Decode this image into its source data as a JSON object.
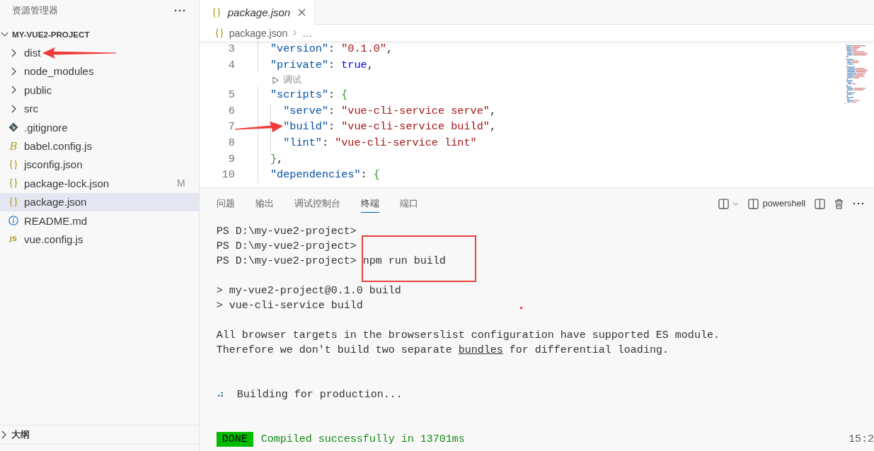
{
  "sidebar": {
    "title": "资源管理器",
    "project": {
      "name": "MY-VUE2-PROJECT",
      "expanded": true,
      "children": [
        {
          "name": "dist",
          "kind": "folder",
          "expanded": false,
          "selected": false,
          "arrow": true
        },
        {
          "name": "node_modules",
          "kind": "folder",
          "expanded": false,
          "selected": false,
          "arrow": false
        },
        {
          "name": "public",
          "kind": "folder",
          "expanded": false,
          "selected": false,
          "arrow": false
        },
        {
          "name": "src",
          "kind": "folder",
          "expanded": false,
          "selected": false,
          "arrow": false
        },
        {
          "name": ".gitignore",
          "kind": "git",
          "selected": false,
          "arrow": false
        },
        {
          "name": "babel.config.js",
          "kind": "italic-glyph",
          "glyph": "B",
          "selected": false,
          "arrow": false
        },
        {
          "name": "jsconfig.json",
          "kind": "json",
          "selected": false,
          "arrow": false
        },
        {
          "name": "package-lock.json",
          "kind": "json",
          "selected": false,
          "arrow": false,
          "badge": "M"
        },
        {
          "name": "package.json",
          "kind": "json",
          "selected": true,
          "arrow": false
        },
        {
          "name": "README.md",
          "kind": "info",
          "selected": false,
          "arrow": false
        },
        {
          "name": "vue.config.js",
          "kind": "glyph",
          "glyph": "JS",
          "selected": false,
          "arrow": false
        }
      ]
    },
    "sections": [
      {
        "name": "大纲",
        "expanded": false
      }
    ]
  },
  "editor": {
    "tabs": [
      {
        "label": "package.json",
        "selected": true,
        "preview": true
      }
    ],
    "breadcrumb": {
      "file": "package.json",
      "rest": "…"
    },
    "lines": [
      {
        "kind": "code",
        "number": "3",
        "arrow": false,
        "tokens": [
          {
            "kind": "key",
            "text": "\"version\""
          },
          {
            "kind": "punct",
            "text": ": "
          },
          {
            "kind": "string",
            "text": "\"0.1.0\""
          },
          {
            "kind": "punct",
            "text": ","
          }
        ]
      },
      {
        "kind": "code",
        "number": "4",
        "arrow": false,
        "tokens": [
          {
            "kind": "key",
            "text": "\"private\""
          },
          {
            "kind": "punct",
            "text": ": "
          },
          {
            "kind": "keyword",
            "text": "true"
          },
          {
            "kind": "punct",
            "text": ","
          }
        ]
      },
      {
        "kind": "codelens",
        "text": "调试"
      },
      {
        "kind": "code",
        "number": "5",
        "arrow": false,
        "tokens": [
          {
            "kind": "key",
            "text": "\"scripts\""
          },
          {
            "kind": "punct",
            "text": ": "
          },
          {
            "kind": "bracket",
            "text": "{"
          }
        ],
        "children": [
          {
            "kind": "code",
            "number": "6",
            "arrow": false,
            "tokens": [
              {
                "kind": "key",
                "text": "\"serve\""
              },
              {
                "kind": "punct",
                "text": ": "
              },
              {
                "kind": "string",
                "text": "\"vue-cli-service serve\""
              },
              {
                "kind": "punct",
                "text": ","
              }
            ]
          },
          {
            "kind": "code",
            "number": "7",
            "arrow": true,
            "tokens": [
              {
                "kind": "key",
                "text": "\"build\""
              },
              {
                "kind": "punct",
                "text": ": "
              },
              {
                "kind": "string",
                "text": "\"vue-cli-service build\""
              },
              {
                "kind": "punct",
                "text": ","
              }
            ]
          },
          {
            "kind": "code",
            "number": "8",
            "arrow": false,
            "tokens": [
              {
                "kind": "key",
                "text": "\"lint\""
              },
              {
                "kind": "punct",
                "text": ": "
              },
              {
                "kind": "string",
                "text": "\"vue-cli-service lint\""
              }
            ]
          }
        ]
      },
      {
        "kind": "code",
        "number": "9",
        "arrow": false,
        "tokens": [
          {
            "kind": "bracket",
            "text": "}"
          },
          {
            "kind": "punct",
            "text": ","
          }
        ]
      },
      {
        "kind": "code",
        "number": "10",
        "arrow": false,
        "tokens": [
          {
            "kind": "key",
            "text": "\"dependencies\""
          },
          {
            "kind": "punct",
            "text": ": "
          },
          {
            "kind": "bracket",
            "text": "{"
          }
        ]
      }
    ]
  },
  "panel": {
    "tabs": [
      {
        "label": "问题",
        "selected": false
      },
      {
        "label": "输出",
        "selected": false
      },
      {
        "label": "调试控制台",
        "selected": false
      },
      {
        "label": "终端",
        "selected": true
      },
      {
        "label": "端口",
        "selected": false
      }
    ],
    "profile": "powershell",
    "terminal": [
      {
        "kind": "prompt",
        "prompt": "PS D:\\my-vue2-project>"
      },
      {
        "kind": "prompt",
        "prompt": "PS D:\\my-vue2-project>"
      },
      {
        "kind": "prompt",
        "prompt": "PS D:\\my-vue2-project>",
        "command": "npm run build",
        "boxed": true
      },
      {
        "kind": "blank"
      },
      {
        "kind": "output",
        "parts": [
          {
            "text": "> my-vue2-project@0.1.0 build",
            "link": false
          }
        ]
      },
      {
        "kind": "output",
        "parts": [
          {
            "text": "> vue-cli-service build",
            "link": false
          }
        ]
      },
      {
        "kind": "blank"
      },
      {
        "kind": "output",
        "parts": [
          {
            "text": "All browser targets in the browserslist configuration have supported ES module.",
            "link": false
          }
        ]
      },
      {
        "kind": "output",
        "parts": [
          {
            "text": "Therefore we don't build two separate ",
            "link": false
          },
          {
            "text": "bundles",
            "link": true
          },
          {
            "text": " for differential loading.",
            "link": false
          }
        ]
      },
      {
        "kind": "blank"
      },
      {
        "kind": "blank"
      },
      {
        "kind": "spinner",
        "spinner": "⠴",
        "text": "Building for production..."
      },
      {
        "kind": "blank"
      },
      {
        "kind": "blank"
      },
      {
        "kind": "done",
        "badge": "DONE",
        "text": "Compiled successfully in 13701ms",
        "time": "15:2"
      }
    ]
  }
}
